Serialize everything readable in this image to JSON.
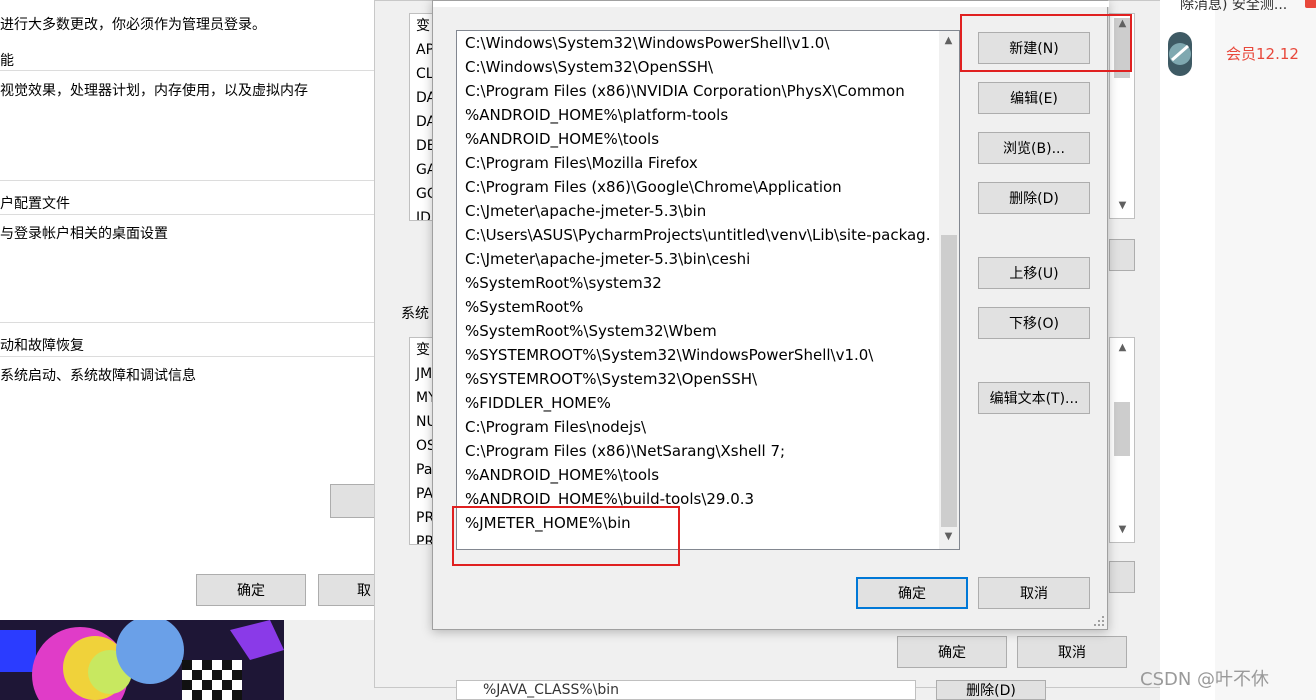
{
  "left_window": {
    "lines": [
      "进行大多数更改，你必须作为管理员登录。",
      "能",
      "视觉效果，处理器计划，内存使用，以及虚拟内存",
      "户配置文件",
      "与登录帐户相关的桌面设置",
      "动和故障恢复",
      "系统启动、系统故障和调试信息"
    ],
    "ok_label": "确定",
    "cancel_label": "取"
  },
  "env_window": {
    "user_vars_header": "变",
    "user_vars": [
      "AP",
      "CL",
      "DA",
      "DA",
      "DE",
      "GA",
      "GO",
      "ID"
    ],
    "system_vars_title": "系统",
    "system_vars_header": "变",
    "system_vars": [
      "JM",
      "MY",
      "NU",
      "OS",
      "Pa",
      "PA",
      "PR",
      "PR"
    ],
    "bottom_item": "%JAVA_CLASS%\\bin",
    "delete_label": "删除(D)",
    "ok_label": "确定",
    "cancel_label": "取消"
  },
  "edit_dialog": {
    "paths": [
      "C:\\Windows\\System32\\WindowsPowerShell\\v1.0\\",
      "C:\\Windows\\System32\\OpenSSH\\",
      "C:\\Program Files (x86)\\NVIDIA Corporation\\PhysX\\Common",
      "%ANDROID_HOME%\\platform-tools",
      "%ANDROID_HOME%\\tools",
      "C:\\Program Files\\Mozilla Firefox",
      "C:\\Program Files (x86)\\Google\\Chrome\\Application",
      "C:\\Jmeter\\apache-jmeter-5.3\\bin",
      "C:\\Users\\ASUS\\PycharmProjects\\untitled\\venv\\Lib\\site-packag...",
      "C:\\Jmeter\\apache-jmeter-5.3\\bin\\ceshi",
      "%SystemRoot%\\system32",
      "%SystemRoot%",
      "%SystemRoot%\\System32\\Wbem",
      "%SYSTEMROOT%\\System32\\WindowsPowerShell\\v1.0\\",
      "%SYSTEMROOT%\\System32\\OpenSSH\\",
      "%FIDDLER_HOME%",
      "C:\\Program Files\\nodejs\\",
      "C:\\Program Files (x86)\\NetSarang\\Xshell 7;",
      "%ANDROID_HOME%\\tools",
      "%ANDROID_HOME%\\build-tools\\29.0.3",
      "%JMETER_HOME%\\bin"
    ],
    "buttons": {
      "new": "新建(N)",
      "edit": "编辑(E)",
      "browse": "浏览(B)...",
      "delete": "删除(D)",
      "move_up": "上移(U)",
      "move_down": "下移(O)",
      "edit_text": "编辑文本(T)...",
      "ok": "确定",
      "cancel": "取消"
    }
  },
  "right_panel": {
    "top_text": "除消息) 安全测...",
    "member_label": "会员12.12",
    "watermark": "CSDN @叶不休"
  },
  "colors": {
    "highlight_red": "#e02020",
    "member_red": "#e8483b",
    "focus_blue": "#0078d7"
  }
}
